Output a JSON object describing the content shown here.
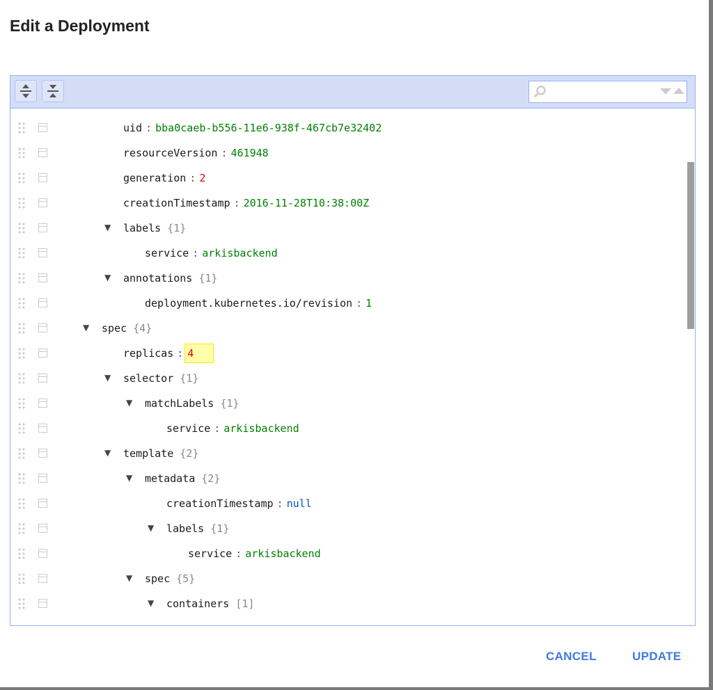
{
  "dialog": {
    "title": "Edit a Deployment"
  },
  "toolbar": {
    "expand_all_icon": "expand-all-icon",
    "collapse_all_icon": "collapse-all-icon",
    "search_placeholder": "",
    "search_icon": "search-icon"
  },
  "tree": {
    "rows": [
      {
        "level": 1,
        "key": "uid",
        "value": "bba0caeb-b556-11e6-938f-467cb7e32402",
        "type": "string"
      },
      {
        "level": 1,
        "key": "resourceVersion",
        "value": "461948",
        "type": "string"
      },
      {
        "level": 1,
        "key": "generation",
        "value": "2",
        "type": "number"
      },
      {
        "level": 1,
        "key": "creationTimestamp",
        "value": "2016-11-28T10:38:00Z",
        "type": "string"
      },
      {
        "level": 1,
        "key": "labels",
        "count": "{1}",
        "type": "object"
      },
      {
        "level": 2,
        "key": "service",
        "value": "arkisbackend",
        "type": "string"
      },
      {
        "level": 1,
        "key": "annotations",
        "count": "{1}",
        "type": "object"
      },
      {
        "level": 2,
        "key": "deployment.kubernetes.io/revision",
        "value": "1",
        "type": "string"
      },
      {
        "level": 0,
        "key": "spec",
        "count": "{4}",
        "type": "object"
      },
      {
        "level": 1,
        "key": "replicas",
        "value": "4",
        "type": "number",
        "highlighted": true
      },
      {
        "level": 1,
        "key": "selector",
        "count": "{1}",
        "type": "object"
      },
      {
        "level": 2,
        "key": "matchLabels",
        "count": "{1}",
        "type": "object"
      },
      {
        "level": 3,
        "key": "service",
        "value": "arkisbackend",
        "type": "string"
      },
      {
        "level": 1,
        "key": "template",
        "count": "{2}",
        "type": "object"
      },
      {
        "level": 2,
        "key": "metadata",
        "count": "{2}",
        "type": "object"
      },
      {
        "level": 3,
        "key": "creationTimestamp",
        "value": "null",
        "type": "null"
      },
      {
        "level": 3,
        "key": "labels",
        "count": "{1}",
        "type": "object"
      },
      {
        "level": 4,
        "key": "service",
        "value": "arkisbackend",
        "type": "string"
      },
      {
        "level": 2,
        "key": "spec",
        "count": "{5}",
        "type": "object"
      },
      {
        "level": 3,
        "key": "containers",
        "count": "[1]",
        "type": "array"
      }
    ]
  },
  "actions": {
    "cancel": "CANCEL",
    "update": "UPDATE"
  }
}
